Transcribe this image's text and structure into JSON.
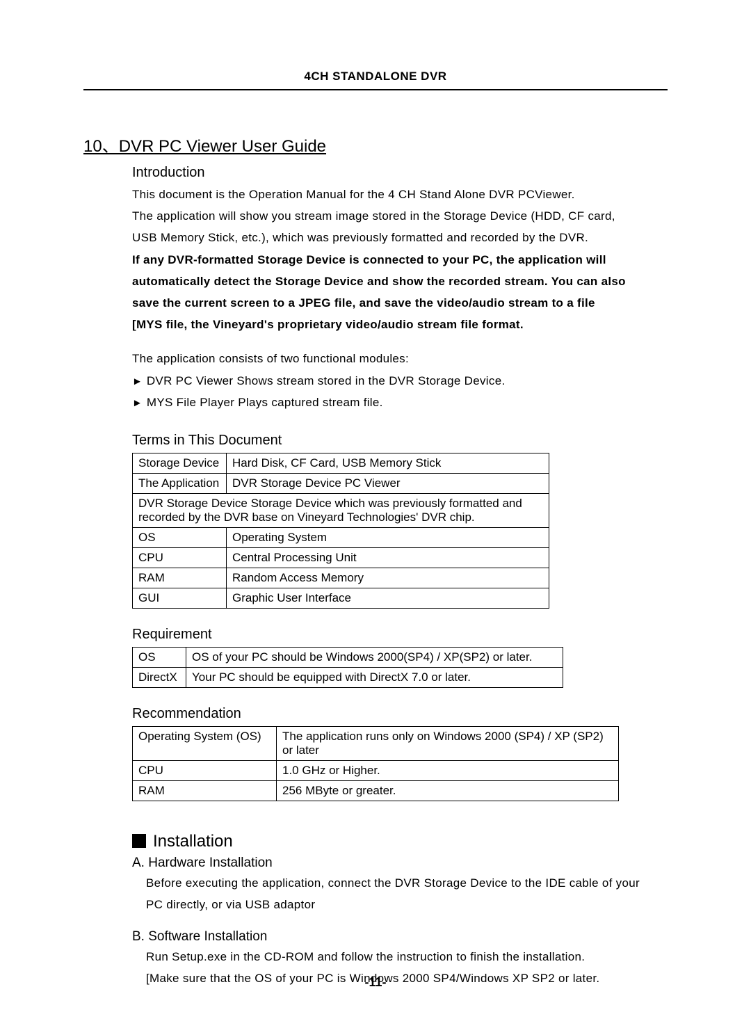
{
  "header": {
    "title": "4CH STANDALONE DVR"
  },
  "section": {
    "number_title": "10、DVR PC Viewer User Guide"
  },
  "intro": {
    "heading": "Introduction",
    "p1": "This document is the Operation Manual for the 4 CH Stand Alone DVR PCViewer.",
    "p2": "The application will show you stream image stored in the Storage Device (HDD, CF card,",
    "p3": "USB Memory Stick, etc.), which was previously formatted and recorded by the DVR.",
    "p4": "If any DVR-formatted Storage Device is connected to your PC, the application will",
    "p5": "automatically detect the Storage Device and show the recorded stream. You can also",
    "p6": "save the current screen to a JPEG file, and save the video/audio stream to a file",
    "p7": "[MYS file, the Vineyard's proprietary video/audio stream file format.",
    "modules_intro": "The application consists of two functional modules:",
    "bullet1": "DVR PC Viewer Shows stream stored in the DVR Storage Device.",
    "bullet2": "MYS File Player Plays captured stream file."
  },
  "terms": {
    "heading": "Terms in This Document",
    "rows": [
      {
        "c1": "Storage Device",
        "c2": "Hard Disk, CF Card, USB Memory Stick"
      },
      {
        "c1": "The Application",
        "c2": "DVR Storage Device PC Viewer"
      }
    ],
    "spanrow": "DVR Storage Device Storage Device which was previously formatted and recorded by the DVR base on Vineyard Technologies' DVR chip.",
    "rows2": [
      {
        "c1": "OS",
        "c2": "Operating System"
      },
      {
        "c1": "CPU",
        "c2": "Central Processing Unit"
      },
      {
        "c1": "RAM",
        "c2": "Random Access Memory"
      },
      {
        "c1": "GUI",
        "c2": "Graphic User Interface"
      }
    ]
  },
  "requirement": {
    "heading": "Requirement",
    "rows": [
      {
        "c1": "OS",
        "c2": "OS of your PC should be Windows 2000(SP4) / XP(SP2) or later."
      },
      {
        "c1": "DirectX",
        "c2": "Your PC should be equipped with DirectX 7.0 or later."
      }
    ]
  },
  "recommendation": {
    "heading": "Recommendation",
    "rows": [
      {
        "c1": "Operating System (OS)",
        "c2": "The application runs only on Windows 2000 (SP4) / XP (SP2) or later"
      },
      {
        "c1": "CPU",
        "c2": "1.0 GHz or Higher."
      },
      {
        "c1": "RAM",
        "c2": "256 MByte or greater."
      }
    ]
  },
  "installation": {
    "heading": "Installation",
    "a_heading": "A. Hardware Installation",
    "a_p1": "Before executing the application, connect the DVR Storage Device to the IDE cable of your",
    "a_p2": "PC directly, or via USB adaptor",
    "b_heading": "B. Software Installation",
    "b_p1": "Run Setup.exe in the CD-ROM and follow the instruction to finish the installation.",
    "b_p2": "[Make sure that the OS of your PC is Windows 2000 SP4/Windows XP SP2 or later."
  },
  "page_number": "-11-"
}
